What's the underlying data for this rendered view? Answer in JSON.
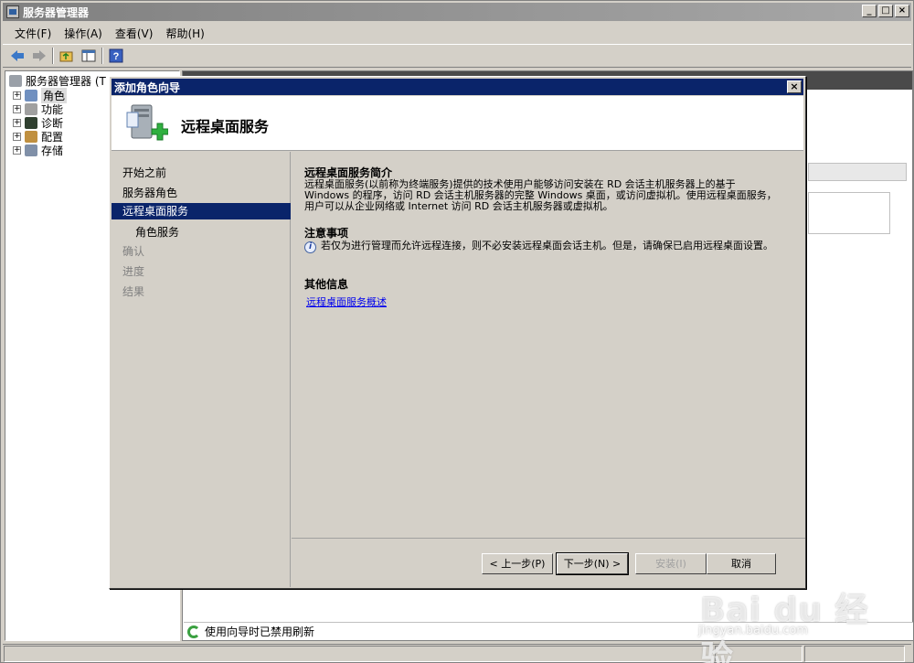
{
  "window": {
    "title": "服务器管理器",
    "min": "_",
    "max": "□",
    "close": "×"
  },
  "menu": [
    "文件(F)",
    "操作(A)",
    "查看(V)",
    "帮助(H)"
  ],
  "tree": {
    "root": "服务器管理器 (T",
    "nodes": [
      "角色",
      "功能",
      "诊断",
      "配置",
      "存储"
    ]
  },
  "status_line": "使用向导时已禁用刷新",
  "wizard": {
    "title": "添加角色向导",
    "banner_title": "远程桌面服务",
    "nav": [
      "开始之前",
      "服务器角色",
      "远程桌面服务",
      "角色服务",
      "确认",
      "进度",
      "结果"
    ],
    "intro_title": "远程桌面服务简介",
    "intro_text": "远程桌面服务(以前称为终端服务)提供的技术使用户能够访问安装在 RD 会话主机服务器上的基于 Windows 的程序，访问 RD 会话主机服务器的完整 Windows 桌面，或访问虚拟机。使用远程桌面服务，用户可以从企业网络或 Internet 访问 RD 会话主机服务器或虚拟机。",
    "notes_title": "注意事项",
    "notes_text": "若仅为进行管理而允许远程连接，则不必安装远程桌面会话主机。但是，请确保已启用远程桌面设置。",
    "more_title": "其他信息",
    "more_link": "远程桌面服务概述",
    "buttons": {
      "prev": "< 上一步(P)",
      "next": "下一步(N) >",
      "install": "安装(I)",
      "cancel": "取消"
    }
  },
  "watermark": {
    "text": "Bai du 经验",
    "sub": "jingyan.baidu.com"
  }
}
